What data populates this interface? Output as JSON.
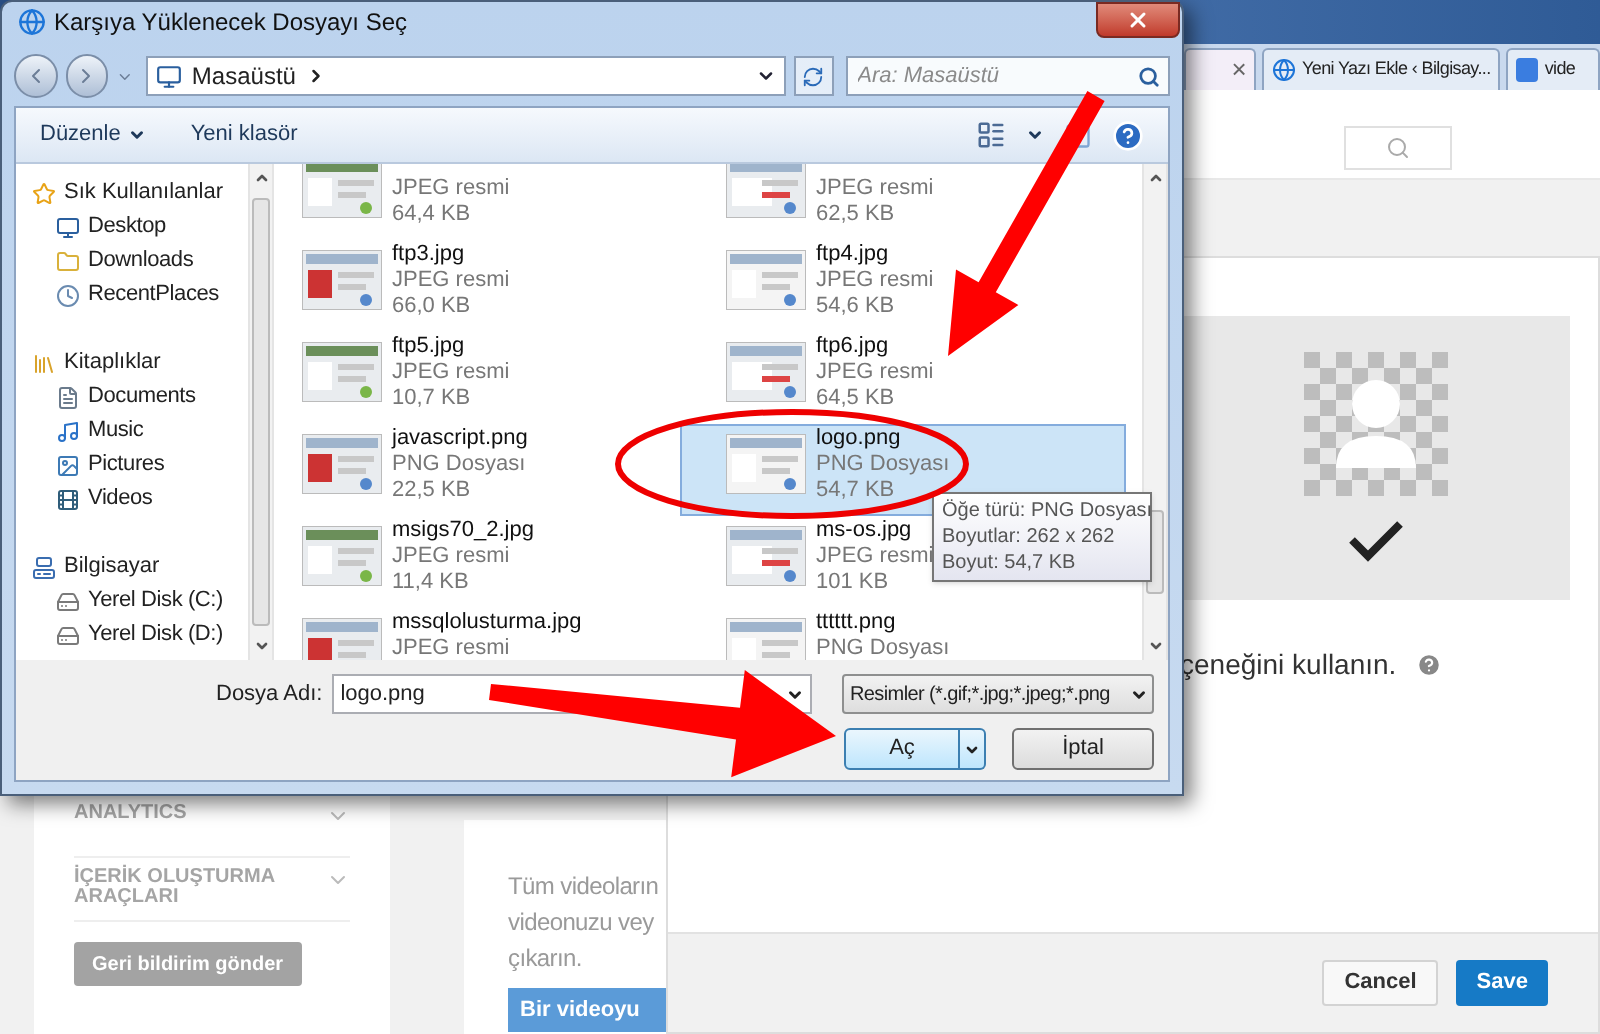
{
  "browser": {
    "tabs": [
      {
        "close": "×",
        "selected": true
      },
      {
        "label": "Yeni Yazı Ekle ‹ Bilgisay...",
        "kind": "ie",
        "selected": false
      },
      {
        "label": "vide",
        "kind": "google",
        "selected": false
      }
    ]
  },
  "page": {
    "sidebar": {
      "items": [
        {
          "label": "ANALYTICS"
        },
        {
          "label": "İÇERİK OLUŞTURMA ARAÇLARI"
        }
      ],
      "feedback_button": "Geri bildirim gönder"
    },
    "main": {
      "lines": [
        "Tüm videoların",
        "videonuzu vey",
        "çıkarın."
      ],
      "button": "Bir videoyu"
    }
  },
  "modal": {
    "hint": "çeneğini kullanın.",
    "buttons": [
      {
        "label": "Cancel",
        "kind": "secondary"
      },
      {
        "label": "Save",
        "kind": "primary"
      }
    ]
  },
  "dialog": {
    "title": "Karşıya Yüklenecek Dosyayı Seç",
    "address": "Masaüstü",
    "search_placeholder": "Ara: Masaüstü",
    "toolbar": [
      {
        "label": "Düzenle",
        "kind": "menu"
      },
      {
        "label": "Yeni klasör",
        "kind": "button"
      }
    ],
    "nav": [
      {
        "label": "Sık Kullanılanlar",
        "kind": "star",
        "children": [
          {
            "label": "Desktop",
            "kind": "desktop"
          },
          {
            "label": "Downloads",
            "kind": "folder"
          },
          {
            "label": "RecentPlaces",
            "kind": "recent"
          }
        ]
      },
      {
        "label": "Kitaplıklar",
        "kind": "library",
        "children": [
          {
            "label": "Documents",
            "kind": "document"
          },
          {
            "label": "Music",
            "kind": "music"
          },
          {
            "label": "Pictures",
            "kind": "pictures"
          },
          {
            "label": "Videos",
            "kind": "videos"
          }
        ]
      },
      {
        "label": "Bilgisayar",
        "kind": "computer",
        "children": [
          {
            "label": "Yerel Disk (C:)",
            "kind": "disk"
          },
          {
            "label": "Yerel Disk (D:)",
            "kind": "disk"
          }
        ]
      }
    ],
    "files": [
      {
        "type": "JPEG resmi",
        "size": "64,4 KB",
        "selected": false
      },
      {
        "type": "JPEG resmi",
        "size": "62,5 KB",
        "selected": false
      },
      {
        "name": "ftp3.jpg",
        "type": "JPEG resmi",
        "size": "66,0 KB",
        "selected": false
      },
      {
        "name": "ftp4.jpg",
        "type": "JPEG resmi",
        "size": "54,6 KB",
        "selected": false
      },
      {
        "name": "ftp5.jpg",
        "type": "JPEG resmi",
        "size": "10,7 KB",
        "selected": false
      },
      {
        "name": "ftp6.jpg",
        "type": "JPEG resmi",
        "size": "64,5 KB",
        "selected": false
      },
      {
        "name": "javascript.png",
        "type": "PNG Dosyası",
        "size": "22,5 KB",
        "selected": false
      },
      {
        "name": "logo.png",
        "type": "PNG Dosyası",
        "size": "54,7 KB",
        "selected": true
      },
      {
        "name": "msigs70_2.jpg",
        "type": "JPEG resmi",
        "size": "11,4 KB",
        "selected": false
      },
      {
        "name": "ms-os.jpg",
        "type": "JPEG resmi",
        "size": "101 KB",
        "selected": false
      },
      {
        "name": "mssqlolusturma.jpg",
        "type": "JPEG resmi",
        "selected": false
      },
      {
        "name": "tttttt.png",
        "type": "PNG Dosyası",
        "selected": false
      }
    ],
    "tooltip": [
      "Öğe türü: PNG Dosyası",
      "Boyutlar: 262 x 262",
      "Boyut: 54,7 KB"
    ],
    "filename_label": "Dosya Adı:",
    "filename": "logo.png",
    "filter": "Resimler (*.gif;*.jpg;*.jpeg;*.png",
    "open_button": "Aç",
    "cancel_button": "İptal"
  }
}
